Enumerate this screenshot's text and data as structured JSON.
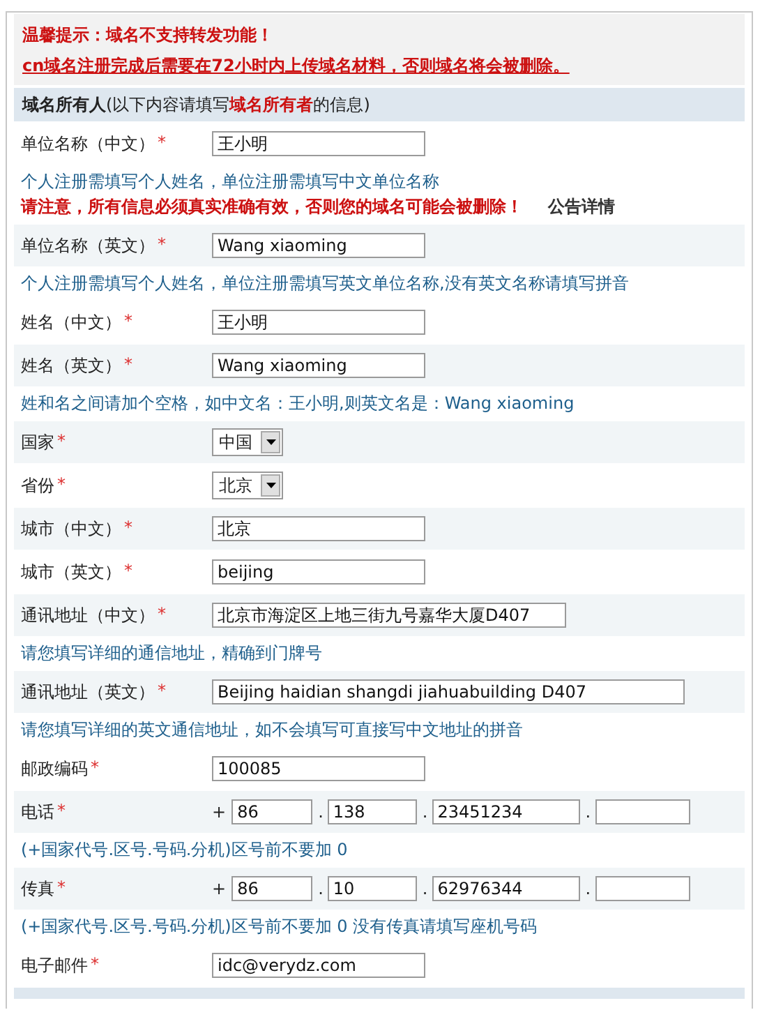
{
  "notice": {
    "title": "温馨提示：域名不支持转发功能！",
    "link": "cn域名注册完成后需要在72小时内上传域名材料，否则域名将会被删除。"
  },
  "section": {
    "title": "域名所有人",
    "note": "(以下内容请填写**域名所有者**的信息)"
  },
  "rows": [
    {
      "kind": "field",
      "label": "单位名称（中文）",
      "mark": "*",
      "value": "王小明",
      "shaded": false
    },
    {
      "kind": "hint",
      "text": "个人注册需填写个人姓名，单位注册需填写中文单位名称",
      "warning": "请注意，所有信息必须真实准确有效，否则您的域名可能会被删除！",
      "link": "公告详情"
    },
    {
      "kind": "field",
      "label": "单位名称（英文）",
      "mark": "*",
      "value": "Wang xiaoming",
      "shaded": true
    },
    {
      "kind": "hint",
      "text": "个人注册需填写个人姓名，单位注册需填写英文单位名称,没有英文名称请填写拼音"
    },
    {
      "kind": "field",
      "label": "姓名（中文）",
      "mark": "*",
      "value": "王小明",
      "shaded": false
    },
    {
      "kind": "field",
      "label": "姓名（英文）",
      "mark": "*",
      "value": "Wang xiaoming",
      "shaded": true
    },
    {
      "kind": "hint",
      "text": "姓和名之间请加个空格，如中文名：王小明,则英文名是：Wang xiaoming"
    },
    {
      "kind": "select",
      "label": "国家",
      "mark": "*",
      "value": "中国",
      "shaded": true
    },
    {
      "kind": "select",
      "label": "省份",
      "mark": "*",
      "value": "北京",
      "shaded": false
    },
    {
      "kind": "field",
      "label": "城市（中文）",
      "mark": "*",
      "value": "北京",
      "shaded": true
    },
    {
      "kind": "field",
      "label": "城市（英文）",
      "mark": "*",
      "value": "beijing",
      "shaded": false
    },
    {
      "kind": "field",
      "label": "通讯地址（中文）",
      "mark": "*",
      "value": "北京市海淀区上地三街九号嘉华大厦D407",
      "shaded": true
    },
    {
      "kind": "hint",
      "text": "请您填写详细的通信地址，精确到门牌号"
    },
    {
      "kind": "field",
      "label": "通讯地址（英文）",
      "mark": "*",
      "value": "Beijing haidian shangdi jiahuabuilding D407",
      "shaded": true
    },
    {
      "kind": "hint",
      "text": "请您填写详细的英文通信地址，如不会填写可直接写中文地址的拼音"
    },
    {
      "kind": "field",
      "label": "邮政编码",
      "mark": "*",
      "value": "100085",
      "shaded": false
    },
    {
      "kind": "phone",
      "label": "电话",
      "mark": "*",
      "prefix": "+",
      "separator": ".",
      "parts": [
        "86",
        "138",
        "23451234"
      ],
      "extension_field": true,
      "shaded": true
    },
    {
      "kind": "hint",
      "text": "(+国家代号.区号.号码.分机)区号前不要加 0"
    },
    {
      "kind": "phone",
      "label": "传真",
      "mark": "*",
      "prefix": "+",
      "separator": ".",
      "parts": [
        "86",
        "10",
        "62976344"
      ],
      "extension_field": true,
      "shaded": true
    },
    {
      "kind": "hint",
      "text": "(+国家代号.区号.号码.分机)区号前不要加 0 没有传真请填写座机号码"
    },
    {
      "kind": "field",
      "label": "电子邮件",
      "mark": "*",
      "value": "idc@verydz.com",
      "shaded": false
    }
  ]
}
